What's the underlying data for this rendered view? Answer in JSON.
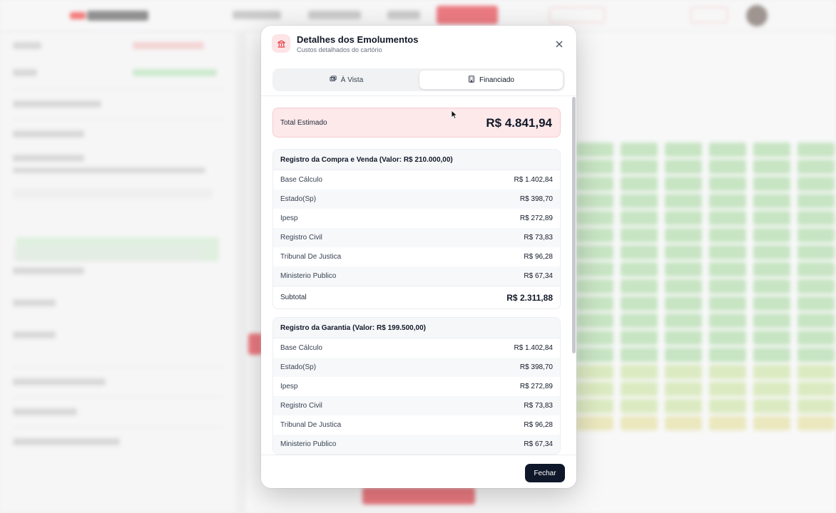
{
  "modal": {
    "title": "Detalhes dos Emolumentos",
    "subtitle": "Custos detalhados do cartório",
    "tabs": [
      {
        "label": "À Vista",
        "icon": "cash-icon",
        "active": false
      },
      {
        "label": "Financiado",
        "icon": "bank-icon",
        "active": true
      }
    ],
    "total": {
      "label": "Total Estimado",
      "value": "R$ 4.841,94"
    },
    "sections": [
      {
        "title": "Registro da Compra e Venda (Valor: R$ 210.000,00)",
        "rows": [
          {
            "label": "Base Cálculo",
            "value": "R$ 1.402,84"
          },
          {
            "label": "Estado(Sp)",
            "value": "R$ 398,70"
          },
          {
            "label": "Ipesp",
            "value": "R$ 272,89"
          },
          {
            "label": "Registro Civil",
            "value": "R$ 73,83"
          },
          {
            "label": "Tribunal De Justica",
            "value": "R$ 96,28"
          },
          {
            "label": "Ministerio Publico",
            "value": "R$ 67,34"
          }
        ],
        "subtotal": {
          "label": "Subtotal",
          "value": "R$ 2.311,88"
        }
      },
      {
        "title": "Registro da Garantia (Valor: R$ 199.500,00)",
        "rows": [
          {
            "label": "Base Cálculo",
            "value": "R$ 1.402,84"
          },
          {
            "label": "Estado(Sp)",
            "value": "R$ 398,70"
          },
          {
            "label": "Ipesp",
            "value": "R$ 272,89"
          },
          {
            "label": "Registro Civil",
            "value": "R$ 73,83"
          },
          {
            "label": "Tribunal De Justica",
            "value": "R$ 96,28"
          },
          {
            "label": "Ministerio Publico",
            "value": "R$ 67,34"
          }
        ]
      }
    ],
    "footer": {
      "close_label": "Fechar"
    }
  },
  "colors": {
    "accent_red": "#e2353f",
    "dark_button": "#0f172a",
    "total_bg": "#fde8ea"
  }
}
